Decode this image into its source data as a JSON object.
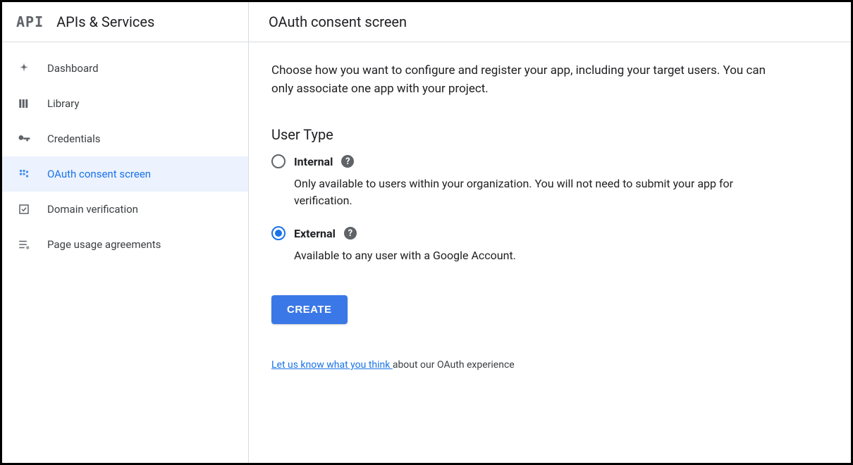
{
  "header": {
    "logo_text": "API",
    "section_title": "APIs & Services",
    "page_title": "OAuth consent screen"
  },
  "sidebar": {
    "items": [
      {
        "label": "Dashboard",
        "active": false
      },
      {
        "label": "Library",
        "active": false
      },
      {
        "label": "Credentials",
        "active": false
      },
      {
        "label": "OAuth consent screen",
        "active": true
      },
      {
        "label": "Domain verification",
        "active": false
      },
      {
        "label": "Page usage agreements",
        "active": false
      }
    ]
  },
  "main": {
    "intro": "Choose how you want to configure and register your app, including your target users. You can only associate one app with your project.",
    "user_type_heading": "User Type",
    "options": {
      "internal": {
        "label": "Internal",
        "description": "Only available to users within your organization. You will not need to submit your app for verification.",
        "selected": false
      },
      "external": {
        "label": "External",
        "description": "Available to any user with a Google Account.",
        "selected": true
      }
    },
    "create_button": "CREATE",
    "feedback_link": "Let us know what you think ",
    "feedback_suffix": "about our OAuth experience"
  }
}
